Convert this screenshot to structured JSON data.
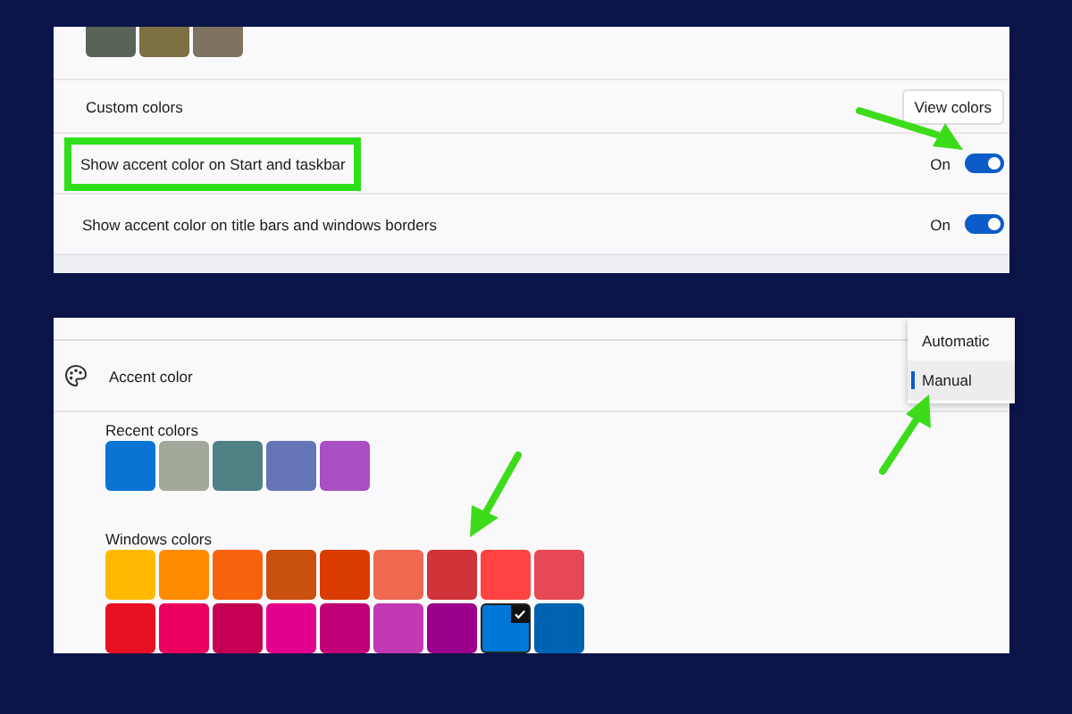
{
  "top_panel": {
    "partial_swatches": [
      {
        "color": "#5a6357"
      },
      {
        "color": "#7d7043"
      },
      {
        "color": "#7e7261"
      }
    ],
    "custom_colors": {
      "label": "Custom colors",
      "button": "View colors"
    },
    "toggles": [
      {
        "label": "Show accent color on Start and taskbar",
        "state_text": "On",
        "on": true,
        "highlighted": true
      },
      {
        "label": "Show accent color on title bars and windows borders",
        "state_text": "On",
        "on": true,
        "highlighted": false
      }
    ]
  },
  "accent": {
    "title": "Accent color",
    "mode_menu": [
      {
        "label": "Automatic",
        "selected": false
      },
      {
        "label": "Manual",
        "selected": true
      }
    ],
    "recent_label": "Recent colors",
    "recent_colors": [
      {
        "color": "#0a74d4"
      },
      {
        "color": "#a3a99a"
      },
      {
        "color": "#4f8185"
      },
      {
        "color": "#6574b6"
      },
      {
        "color": "#a94fc1"
      }
    ],
    "windows_label": "Windows colors",
    "windows_colors": [
      {
        "color": "#ffb900",
        "selected": false
      },
      {
        "color": "#ff8c00",
        "selected": false
      },
      {
        "color": "#f7630c",
        "selected": false
      },
      {
        "color": "#ca5010",
        "selected": false
      },
      {
        "color": "#da3b01",
        "selected": false
      },
      {
        "color": "#ef6950",
        "selected": false
      },
      {
        "color": "#d13438",
        "selected": false
      },
      {
        "color": "#ff4343",
        "selected": false
      },
      {
        "color": "#e74856",
        "selected": false
      },
      {
        "color": "#e81123",
        "selected": false
      },
      {
        "color": "#ea005e",
        "selected": false
      },
      {
        "color": "#c30052",
        "selected": false
      },
      {
        "color": "#e3008c",
        "selected": false
      },
      {
        "color": "#bf0077",
        "selected": false
      },
      {
        "color": "#c239b3",
        "selected": false
      },
      {
        "color": "#9a0089",
        "selected": false
      },
      {
        "color": "#0078d7",
        "selected": true
      },
      {
        "color": "#0063b1",
        "selected": false
      }
    ]
  }
}
